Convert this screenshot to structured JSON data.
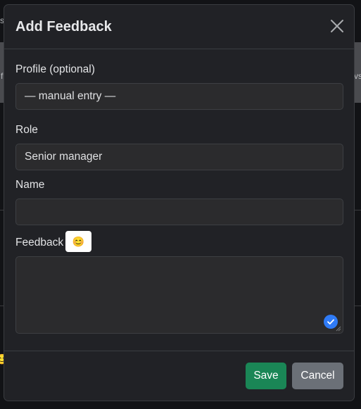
{
  "background": {
    "fragment_top": "s",
    "fragment_left": "f",
    "fragment_right": "vs",
    "emoji": "😊"
  },
  "modal": {
    "title": "Add Feedback",
    "close_icon": "close-icon",
    "profile": {
      "label": "Profile (optional)",
      "selected": "— manual entry —"
    },
    "role": {
      "label": "Role",
      "value": "Senior manager"
    },
    "name": {
      "label": "Name",
      "value": ""
    },
    "feedback": {
      "label": "Feedback",
      "emoji_button": "😊",
      "value": ""
    },
    "footer": {
      "save_label": "Save",
      "cancel_label": "Cancel"
    }
  },
  "colors": {
    "save": "#1a8656",
    "cancel": "#6b7077",
    "check": "#2f7bf6"
  }
}
